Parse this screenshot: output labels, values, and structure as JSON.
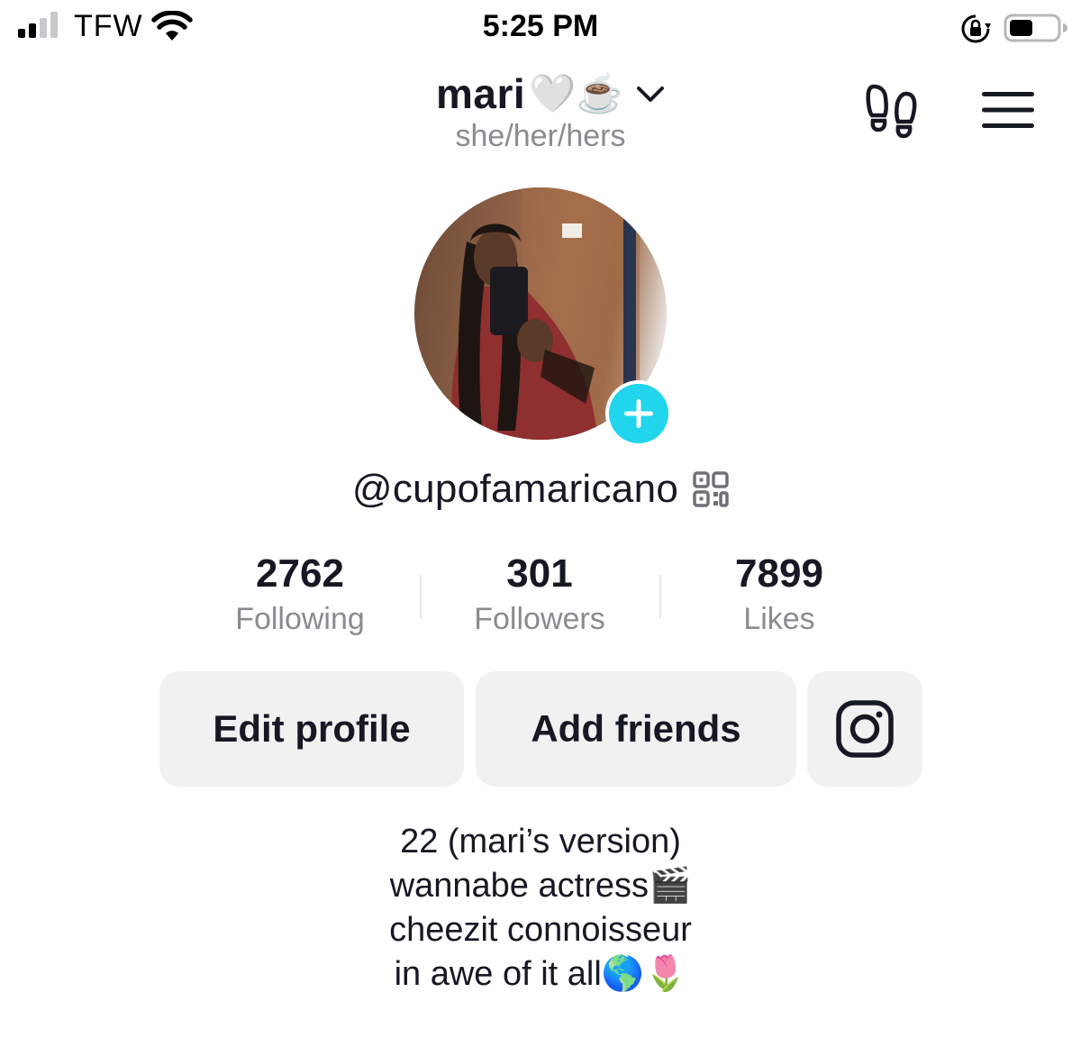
{
  "status_bar": {
    "carrier": "TFW",
    "time": "5:25 PM",
    "signal_bars_filled": 2,
    "signal_bars_total": 4,
    "battery_level": 0.5
  },
  "header": {
    "display_name": "mari",
    "name_emojis": "🤍☕️",
    "pronouns": "she/her/hers",
    "icons": [
      "chevron-down",
      "footprints",
      "menu"
    ]
  },
  "profile": {
    "username": "@cupofamaricano",
    "avatar_badge_icon": "plus",
    "accent_color": "#20d5ec"
  },
  "stats": [
    {
      "value": "2762",
      "label": "Following"
    },
    {
      "value": "301",
      "label": "Followers"
    },
    {
      "value": "7899",
      "label": "Likes"
    }
  ],
  "buttons": {
    "edit_profile": "Edit profile",
    "add_friends": "Add friends",
    "instagram_icon": "instagram"
  },
  "bio": [
    "22 (mari’s version)",
    "wannabe actress🎬",
    "cheezit connoisseur",
    "in awe of it all🌎🌷"
  ]
}
